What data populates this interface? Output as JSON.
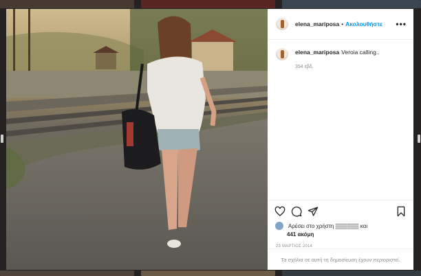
{
  "post": {
    "username": "elena_mariposa",
    "follow_label": "Ακολουθήστε",
    "more_label": "•••",
    "caption_text": "Veroia calling..",
    "time_ago": "354 εβδ.",
    "likes_text": "Αρέσει στο χρήστη",
    "likes_suffix": "και",
    "likes_count": "441 ακόμη",
    "date": "23 ΜΑΡΤΙΟΣ 2014",
    "comments_disabled": "Τα σχόλια σε αυτή τη δημοσίευση έχουν περιοριστεί."
  },
  "icons": {
    "like": "heart-icon",
    "comment": "comment-icon",
    "share": "paper-plane-icon",
    "save": "bookmark-icon",
    "more": "more-options-icon"
  },
  "colors": {
    "follow": "#0095f6",
    "text": "#262626",
    "muted": "#8e8e8e"
  }
}
